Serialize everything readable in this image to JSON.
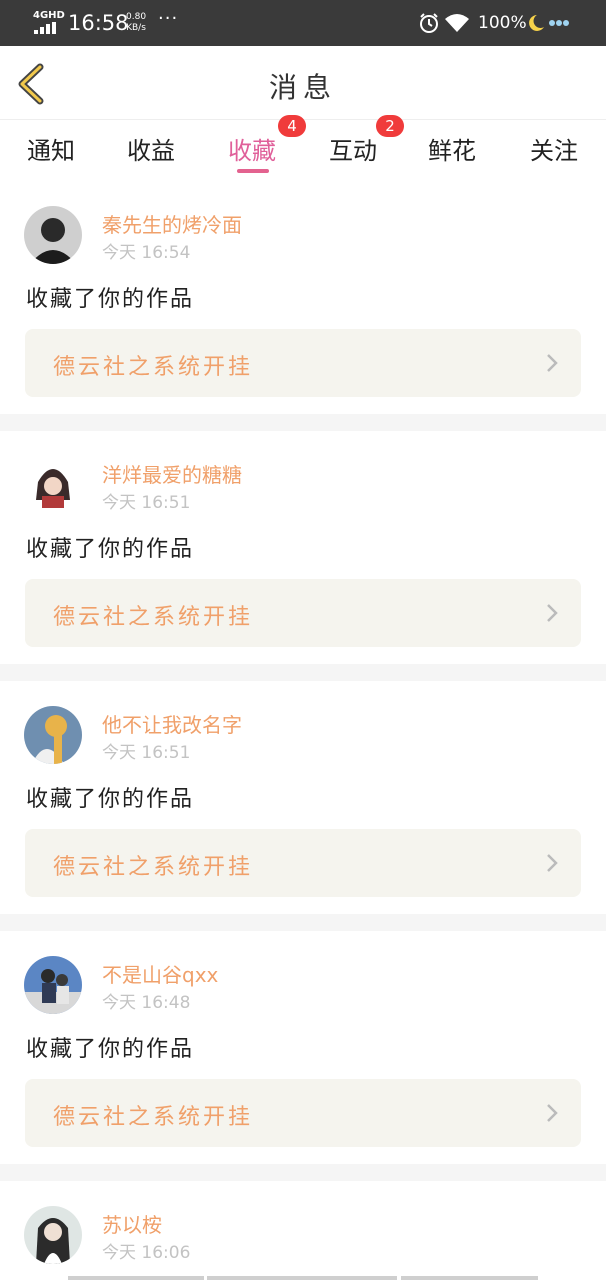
{
  "status_bar": {
    "network": "4GHD",
    "time": "16:58",
    "speed_value": "0.80",
    "speed_unit": "KB/s",
    "more": "···",
    "battery": "100%",
    "icons": [
      "signal-icon",
      "alarm-icon",
      "wifi-icon",
      "moon-icon"
    ]
  },
  "header": {
    "title": "消息",
    "back_icon": "chevron-left-icon"
  },
  "tabs": [
    {
      "label": "通知"
    },
    {
      "label": "收益"
    },
    {
      "label": "收藏",
      "badge": "4",
      "active": true
    },
    {
      "label": "互动",
      "badge": "2"
    },
    {
      "label": "鲜花"
    },
    {
      "label": "关注"
    }
  ],
  "feed": [
    {
      "user": "秦先生的烤冷面",
      "time": "今天 16:54",
      "action": "收藏了你的作品",
      "work": "德云社之系统开挂"
    },
    {
      "user": "洋烊最爱的糖糖",
      "time": "今天 16:51",
      "action": "收藏了你的作品",
      "work": "德云社之系统开挂"
    },
    {
      "user": "他不让我改名字",
      "time": "今天 16:51",
      "action": "收藏了你的作品",
      "work": "德云社之系统开挂"
    },
    {
      "user": "不是山谷qxx",
      "time": "今天 16:48",
      "action": "收藏了你的作品",
      "work": "德云社之系统开挂"
    },
    {
      "user": "苏以桉",
      "time": "今天 16:06",
      "action": "",
      "work": ""
    }
  ],
  "colors": {
    "accent_pink": "#e0609a",
    "badge_red": "#f03b3b",
    "name_orange": "#f0a06a",
    "card_bg": "#f5f4ee"
  }
}
